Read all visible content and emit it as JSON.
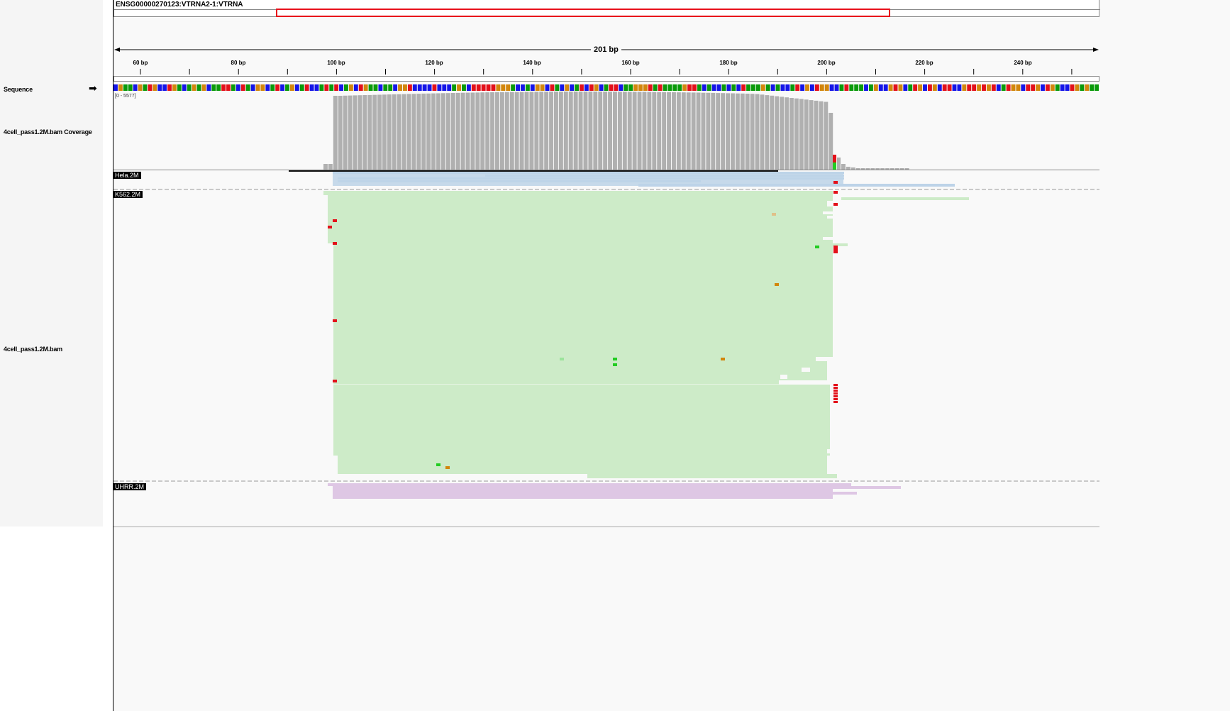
{
  "locus": {
    "name": "ENSG00000270123:VTRNA2-1:VTRNA"
  },
  "ruler": {
    "span": "201 bp",
    "ticks": [
      "60 bp",
      "80 bp",
      "100 bp",
      "120 bp",
      "140 bp",
      "160 bp",
      "180 bp",
      "200 bp",
      "220 bp",
      "240 bp"
    ]
  },
  "tracks": {
    "sequence": {
      "label": "Sequence",
      "arrow": "➡"
    },
    "coverage": {
      "label": "4cell_pass1.2M.bam Coverage",
      "range": "[0 - 5577]"
    },
    "alignments": {
      "label": "4cell_pass1.2M.bam"
    }
  },
  "samples": {
    "hela": "Hela.2M",
    "k562": "K562.2M",
    "uhrr": "UHRR.2M"
  },
  "colors": {
    "base_A": "#0a9a0a",
    "base_C": "#1515e8",
    "base_G": "#d2860c",
    "base_T": "#e3101a",
    "coverage": "#b0b0b0",
    "hela": "#bdd3e8",
    "k562": "#cdebc8",
    "uhrr": "#dec7e4",
    "mismatch_T": "#e3101a",
    "mismatch_A": "#22cc22",
    "mismatch_G": "#d2860c",
    "region": "#e8111b"
  },
  "icons": {
    "direction": "right-arrow-icon"
  }
}
